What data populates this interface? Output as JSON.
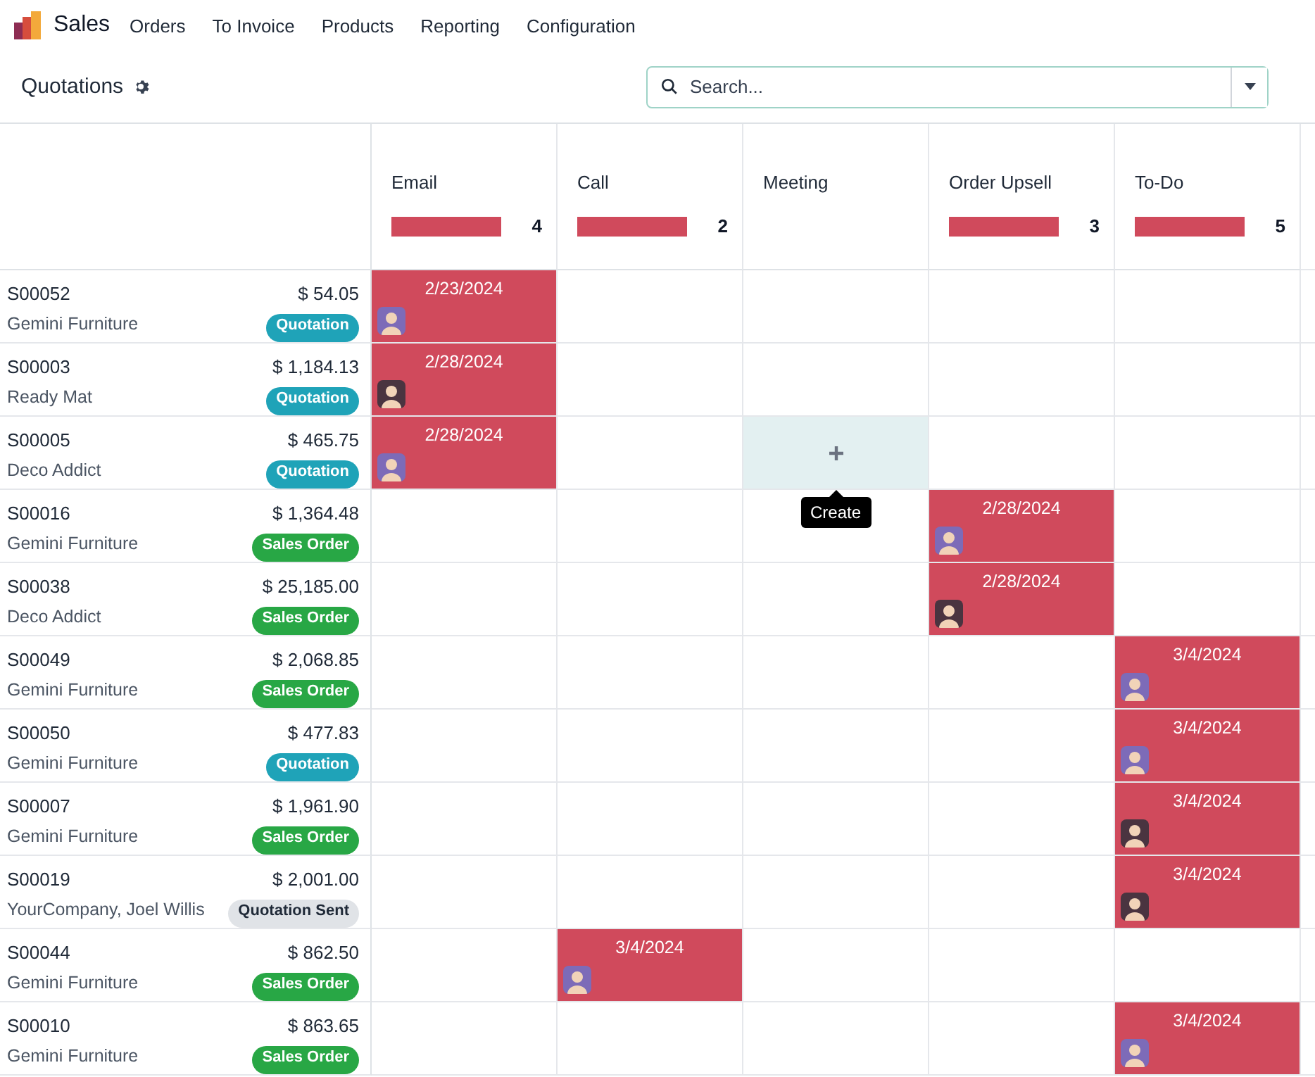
{
  "app": {
    "name": "Sales",
    "menu": [
      "Orders",
      "To Invoice",
      "Products",
      "Reporting",
      "Configuration"
    ]
  },
  "page": {
    "title": "Quotations"
  },
  "search": {
    "placeholder": "Search..."
  },
  "columns": [
    {
      "label": "Email",
      "count": "4",
      "level": 1
    },
    {
      "label": "Call",
      "count": "2",
      "level": 1
    },
    {
      "label": "Meeting"
    },
    {
      "label": "Order Upsell",
      "count": "3",
      "level": 1
    },
    {
      "label": "To-Do",
      "count": "5",
      "level": 1
    }
  ],
  "rows": [
    {
      "ref": "S00052",
      "customer": "Gemini Furniture",
      "amount": "$ 54.05",
      "status": {
        "kind": "quotation",
        "label": "Quotation"
      },
      "cells": [
        {
          "kind": "activity",
          "date": "2/23/2024",
          "color": "#7d6bb8"
        },
        {
          "kind": "empty"
        },
        {
          "kind": "empty"
        },
        {
          "kind": "empty"
        },
        {
          "kind": "empty"
        }
      ]
    },
    {
      "ref": "S00003",
      "customer": "Ready Mat",
      "amount": "$ 1,184.13",
      "status": {
        "kind": "quotation",
        "label": "Quotation"
      },
      "cells": [
        {
          "kind": "activity",
          "date": "2/28/2024",
          "color": "#4a3440"
        },
        {
          "kind": "empty"
        },
        {
          "kind": "empty"
        },
        {
          "kind": "empty"
        },
        {
          "kind": "empty"
        }
      ]
    },
    {
      "ref": "S00005",
      "customer": "Deco Addict",
      "amount": "$ 465.75",
      "status": {
        "kind": "quotation",
        "label": "Quotation"
      },
      "cells": [
        {
          "kind": "activity",
          "date": "2/28/2024",
          "color": "#7d6bb8"
        },
        {
          "kind": "empty"
        },
        {
          "kind": "create",
          "tooltip": "Create"
        },
        {
          "kind": "empty"
        },
        {
          "kind": "empty"
        }
      ]
    },
    {
      "ref": "S00016",
      "customer": "Gemini Furniture",
      "amount": "$ 1,364.48",
      "status": {
        "kind": "sales_order",
        "label": "Sales Order"
      },
      "cells": [
        {
          "kind": "empty"
        },
        {
          "kind": "empty"
        },
        {
          "kind": "empty"
        },
        {
          "kind": "activity",
          "date": "2/28/2024",
          "color": "#7d6bb8"
        },
        {
          "kind": "empty"
        }
      ]
    },
    {
      "ref": "S00038",
      "customer": "Deco Addict",
      "amount": "$ 25,185.00",
      "status": {
        "kind": "sales_order",
        "label": "Sales Order"
      },
      "cells": [
        {
          "kind": "empty"
        },
        {
          "kind": "empty"
        },
        {
          "kind": "empty"
        },
        {
          "kind": "activity",
          "date": "2/28/2024",
          "color": "#4a3440"
        },
        {
          "kind": "empty"
        }
      ]
    },
    {
      "ref": "S00049",
      "customer": "Gemini Furniture",
      "amount": "$ 2,068.85",
      "status": {
        "kind": "sales_order",
        "label": "Sales Order"
      },
      "cells": [
        {
          "kind": "empty"
        },
        {
          "kind": "empty"
        },
        {
          "kind": "empty"
        },
        {
          "kind": "empty"
        },
        {
          "kind": "activity",
          "date": "3/4/2024",
          "color": "#7d6bb8"
        }
      ]
    },
    {
      "ref": "S00050",
      "customer": "Gemini Furniture",
      "amount": "$ 477.83",
      "status": {
        "kind": "quotation",
        "label": "Quotation"
      },
      "cells": [
        {
          "kind": "empty"
        },
        {
          "kind": "empty"
        },
        {
          "kind": "empty"
        },
        {
          "kind": "empty"
        },
        {
          "kind": "activity",
          "date": "3/4/2024",
          "color": "#7d6bb8"
        }
      ]
    },
    {
      "ref": "S00007",
      "customer": "Gemini Furniture",
      "amount": "$ 1,961.90",
      "status": {
        "kind": "sales_order",
        "label": "Sales Order"
      },
      "cells": [
        {
          "kind": "empty"
        },
        {
          "kind": "empty"
        },
        {
          "kind": "empty"
        },
        {
          "kind": "empty"
        },
        {
          "kind": "activity",
          "date": "3/4/2024",
          "color": "#4a3440"
        }
      ]
    },
    {
      "ref": "S00019",
      "customer": "YourCompany, Joel Willis",
      "amount": "$ 2,001.00",
      "status": {
        "kind": "sent",
        "label": "Quotation Sent"
      },
      "cells": [
        {
          "kind": "empty"
        },
        {
          "kind": "empty"
        },
        {
          "kind": "empty"
        },
        {
          "kind": "empty"
        },
        {
          "kind": "activity",
          "date": "3/4/2024",
          "color": "#4a3440"
        }
      ]
    },
    {
      "ref": "S00044",
      "customer": "Gemini Furniture",
      "amount": "$ 862.50",
      "status": {
        "kind": "sales_order",
        "label": "Sales Order"
      },
      "cells": [
        {
          "kind": "empty"
        },
        {
          "kind": "activity",
          "date": "3/4/2024",
          "color": "#7d6bb8"
        },
        {
          "kind": "empty"
        },
        {
          "kind": "empty"
        },
        {
          "kind": "empty"
        }
      ]
    },
    {
      "ref": "S00010",
      "customer": "Gemini Furniture",
      "amount": "$ 863.65",
      "status": {
        "kind": "sales_order",
        "label": "Sales Order"
      },
      "cells": [
        {
          "kind": "empty"
        },
        {
          "kind": "empty"
        },
        {
          "kind": "empty"
        },
        {
          "kind": "empty"
        },
        {
          "kind": "activity",
          "date": "3/4/2024",
          "color": "#7d6bb8"
        }
      ]
    }
  ]
}
